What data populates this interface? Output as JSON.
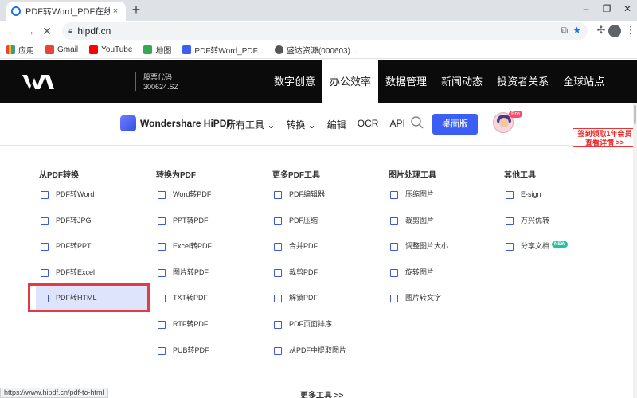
{
  "browser": {
    "tab_title": "PDF转Word_PDF在线转换_免费",
    "tab_close": "×",
    "new_tab": "+",
    "window_controls": [
      "–",
      "❐",
      "✕"
    ],
    "url": "hipdf.cn",
    "bookmarks": [
      {
        "label": "应用",
        "color": "#e94235"
      },
      {
        "label": "Gmail",
        "color": "#ea4335"
      },
      {
        "label": "YouTube",
        "color": "#ff0000"
      },
      {
        "label": "地图",
        "color": "#34a853"
      },
      {
        "label": "PDF转Word_PDF...",
        "color": "#3b5ff5"
      },
      {
        "label": "盛达资源(000603)...",
        "color": "#555555"
      }
    ],
    "status_url": "https://www.hipdf.cn/pdf-to-html"
  },
  "site_header": {
    "stock_label": "股票代码",
    "stock_code": "300624.SZ",
    "nav": [
      {
        "label": "数字创意",
        "active": false
      },
      {
        "label": "办公效率",
        "active": true
      },
      {
        "label": "数据管理",
        "active": false
      },
      {
        "label": "新闻动态",
        "active": false
      },
      {
        "label": "投资者关系",
        "active": false
      },
      {
        "label": "全球站点",
        "active": false
      }
    ]
  },
  "hipdf_nav": {
    "brand": "Wondershare HiPDF",
    "links": [
      "所有工具 ⌄",
      "转换 ⌄",
      "编辑",
      "OCR",
      "API"
    ],
    "desktop_button": "桌面版",
    "pro_badge": "Pro"
  },
  "promo": {
    "line1": "签到领取1年会员",
    "line2": "查看详情 >>"
  },
  "menu": {
    "columns": [
      {
        "title": "从PDF转换",
        "items": [
          "PDF转Word",
          "PDF转JPG",
          "PDF转PPT",
          "PDF转Excel",
          "PDF转HTML"
        ]
      },
      {
        "title": "转换为PDF",
        "items": [
          "Word转PDF",
          "PPT转PDF",
          "Excel转PDF",
          "图片转PDF",
          "TXT转PDF",
          "RTF转PDF",
          "PUB转PDF"
        ]
      },
      {
        "title": "更多PDF工具",
        "items": [
          "PDF编辑器",
          "PDF压缩",
          "合并PDF",
          "裁剪PDF",
          "解锁PDF",
          "PDF页面排序",
          "从PDF中提取图片"
        ]
      },
      {
        "title": "图片处理工具",
        "items": [
          "压缩图片",
          "裁剪图片",
          "调整图片大小",
          "旋转图片",
          "图片转文字"
        ]
      },
      {
        "title": "其他工具",
        "items": [
          "E-sign",
          "万兴优转",
          "分享文档"
        ]
      }
    ],
    "new_badge": "NEW",
    "more_tools": "更多工具 >>"
  }
}
